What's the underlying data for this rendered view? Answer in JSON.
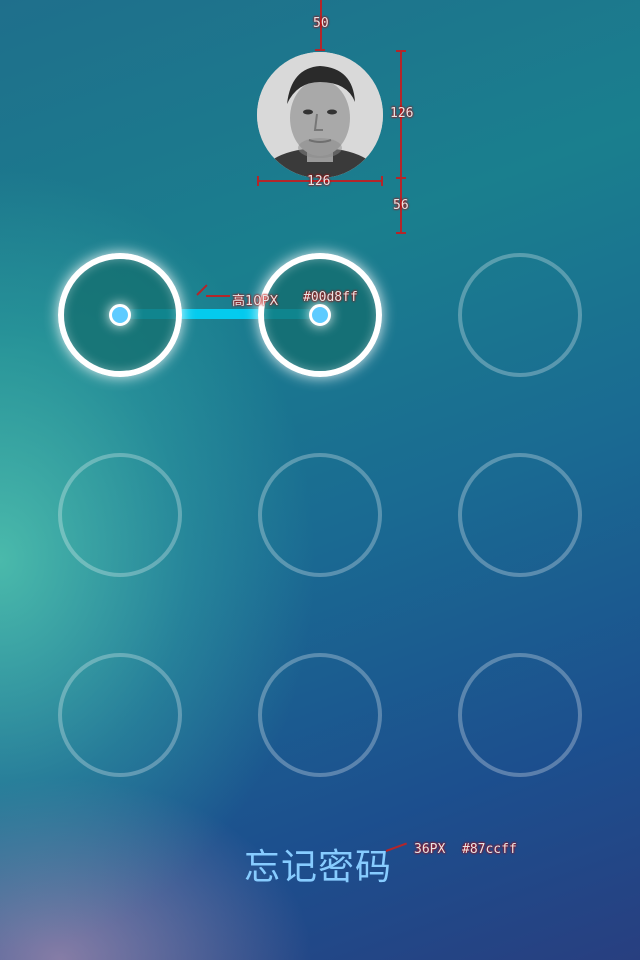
{
  "avatar": {
    "alt": "user-avatar"
  },
  "pattern": {
    "nodes": [
      {
        "id": 1,
        "selected": true
      },
      {
        "id": 2,
        "selected": true
      },
      {
        "id": 3,
        "selected": false
      },
      {
        "id": 4,
        "selected": false
      },
      {
        "id": 5,
        "selected": false
      },
      {
        "id": 6,
        "selected": false
      },
      {
        "id": 7,
        "selected": false
      },
      {
        "id": 8,
        "selected": false
      },
      {
        "id": 9,
        "selected": false
      }
    ],
    "path": [
      1,
      2
    ],
    "line_color": "#00d8ff"
  },
  "annotations": {
    "top_gap": "50",
    "avatar_height": "126",
    "avatar_width": "126",
    "avatar_bottom_gap": "56",
    "line_height": "高10PX",
    "line_color": "#00d8ff",
    "forgot_font_size": "36PX",
    "forgot_color": "#87ccff"
  },
  "forgot_password": {
    "label": "忘记密码",
    "color": "#87ccff"
  }
}
